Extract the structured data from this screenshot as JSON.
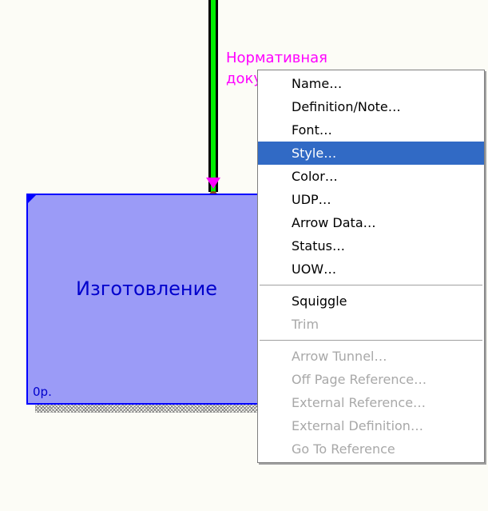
{
  "diagram": {
    "arrow_label_line1": "Нормативная",
    "arrow_label_line2": "доку",
    "arrow_color": "#00ee00",
    "arrow_tip_color": "#ff00ff",
    "activity_title": "Изготовление",
    "activity_cost": "0р.",
    "activity_fill": "#9b9bf7",
    "activity_border": "#0000ff"
  },
  "context_menu": {
    "selected_color": "#316ac5",
    "items": [
      {
        "label": "Name…",
        "enabled": true,
        "selected": false
      },
      {
        "label": "Definition/Note…",
        "enabled": true,
        "selected": false
      },
      {
        "label": "Font…",
        "enabled": true,
        "selected": false
      },
      {
        "label": "Style…",
        "enabled": true,
        "selected": true
      },
      {
        "label": "Color…",
        "enabled": true,
        "selected": false
      },
      {
        "label": "UDP…",
        "enabled": true,
        "selected": false
      },
      {
        "label": "Arrow Data…",
        "enabled": true,
        "selected": false
      },
      {
        "label": "Status…",
        "enabled": true,
        "selected": false
      },
      {
        "label": "UOW…",
        "enabled": true,
        "selected": false
      },
      {
        "label": "Squiggle",
        "enabled": true,
        "selected": false
      },
      {
        "label": "Trim",
        "enabled": false,
        "selected": false
      },
      {
        "label": "Arrow Tunnel…",
        "enabled": false,
        "selected": false
      },
      {
        "label": "Off Page Reference…",
        "enabled": false,
        "selected": false
      },
      {
        "label": "External Reference…",
        "enabled": false,
        "selected": false
      },
      {
        "label": "External Definition…",
        "enabled": false,
        "selected": false
      },
      {
        "label": "Go To Reference",
        "enabled": false,
        "selected": false
      }
    ]
  }
}
